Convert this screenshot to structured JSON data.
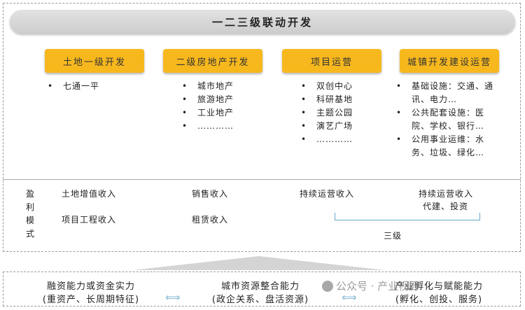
{
  "title": "一二三级联动开发",
  "columns": [
    {
      "header": "土地一级开发",
      "items": [
        "七通一平"
      ]
    },
    {
      "header": "二级房地产开发",
      "items": [
        "城市地产",
        "旅游地产",
        "工业地产",
        "…………"
      ]
    },
    {
      "header": "项目运营",
      "items": [
        "双创中心",
        "科研基地",
        "主题公园",
        "演艺广场",
        "…………"
      ]
    },
    {
      "header": "城镇开发建设运营",
      "items": [
        "基础设施：交通、通讯、电力…",
        "公共配套设施：医院、学校、银行…",
        "公用事业运维：水务、垃圾、绿化…"
      ]
    }
  ],
  "profit_model": {
    "label": "盈利模式",
    "col1": [
      "土地增值收入",
      "项目工程收入"
    ],
    "col2": [
      "销售收入",
      "租赁收入"
    ],
    "col3": [
      "持续运营收入"
    ],
    "col4": [
      "持续运营收入",
      "代建、投资"
    ],
    "bracket_label": "三级"
  },
  "capabilities": [
    {
      "line1": "融资能力或资金实力",
      "line2": "(重资产、长周期特征)"
    },
    {
      "line1": "城市资源整合能力",
      "line2": "(政企关系、盘活资源)"
    },
    {
      "line1": "产业孵化与赋能能力",
      "line2": "(孵化、创投、服务)"
    }
  ],
  "watermark": "公众号 · 产业视野"
}
